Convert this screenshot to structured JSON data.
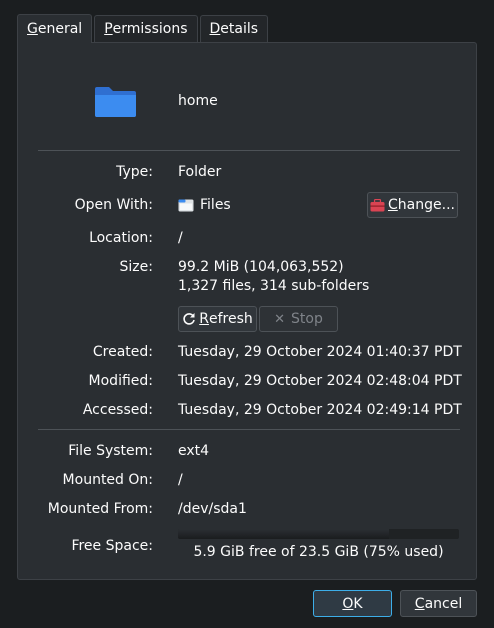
{
  "tabs": [
    {
      "label": "General",
      "mnemonic": "G",
      "rest": "eneral",
      "active": true
    },
    {
      "label": "Permissions",
      "mnemonic": "P",
      "rest": "ermissions",
      "active": false
    },
    {
      "label": "Details",
      "mnemonic": "D",
      "rest": "etails",
      "active": false
    }
  ],
  "file": {
    "name": "home",
    "icon": "folder-icon"
  },
  "fields": {
    "type": {
      "label": "Type:",
      "value": "Folder"
    },
    "open_with": {
      "label": "Open With:",
      "app": "Files",
      "app_icon": "file-manager-icon",
      "change_label": "Change...",
      "change_mnemonic": "C",
      "change_rest": "hange..."
    },
    "location": {
      "label": "Location:",
      "value": "/"
    },
    "size": {
      "label": "Size:",
      "value": "99.2 MiB (104,063,552)",
      "counts": "1,327 files, 314 sub-folders"
    },
    "refresh": {
      "label": "Refresh",
      "mnemonic": "R",
      "rest": "efresh"
    },
    "stop": {
      "label": "Stop"
    },
    "created": {
      "label": "Created:",
      "value": "Tuesday, 29 October 2024 01:40:37 PDT"
    },
    "modified": {
      "label": "Modified:",
      "value": "Tuesday, 29 October 2024 02:48:04 PDT"
    },
    "accessed": {
      "label": "Accessed:",
      "value": "Tuesday, 29 October 2024 02:49:14 PDT"
    },
    "file_system": {
      "label": "File System:",
      "value": "ext4"
    },
    "mounted_on": {
      "label": "Mounted On:",
      "value": "/"
    },
    "mounted_from": {
      "label": "Mounted From:",
      "value": "/dev/sda1"
    },
    "free_space": {
      "label": "Free Space:",
      "text": "5.9 GiB free of 23.5 GiB (75% used)",
      "used_fraction": 0.75
    }
  },
  "buttons": {
    "ok": {
      "label": "OK",
      "mnemonic": "O",
      "rest": "K"
    },
    "cancel": {
      "label": "Cancel",
      "mnemonic": "C",
      "rest": "ancel"
    }
  },
  "colors": {
    "accent": "#3daee9",
    "folder": "#3c8cf0",
    "window_bg": "#2a2e32"
  }
}
